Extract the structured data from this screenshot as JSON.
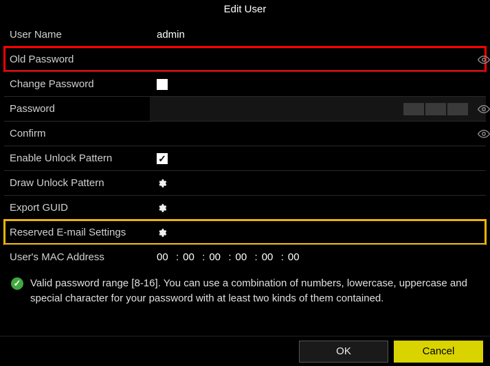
{
  "title": "Edit User",
  "highlights": {
    "old_password": "red",
    "reserved_email": "yellow"
  },
  "fields": {
    "user_name": {
      "label": "User Name",
      "value": "admin"
    },
    "old_password": {
      "label": "Old Password",
      "value": ""
    },
    "change_password": {
      "label": "Change Password",
      "checked": false
    },
    "password": {
      "label": "Password",
      "value": ""
    },
    "confirm": {
      "label": "Confirm",
      "value": ""
    },
    "enable_unlock_pattern": {
      "label": "Enable Unlock Pattern",
      "checked": true
    },
    "draw_unlock_pattern": {
      "label": "Draw Unlock Pattern"
    },
    "export_guid": {
      "label": "Export GUID"
    },
    "reserved_email": {
      "label": "Reserved E-mail Settings"
    },
    "mac": {
      "label": "User's MAC Address",
      "octets": [
        "00",
        "00",
        "00",
        "00",
        "00",
        "00"
      ]
    }
  },
  "hint": "Valid password range [8-16]. You can use a combination of numbers, lowercase, uppercase and special character for your password with at least two kinds of them contained.",
  "buttons": {
    "ok": "OK",
    "cancel": "Cancel"
  },
  "icons": {
    "eye": "eye-icon",
    "gear": "gear-icon",
    "check": "check-icon"
  }
}
